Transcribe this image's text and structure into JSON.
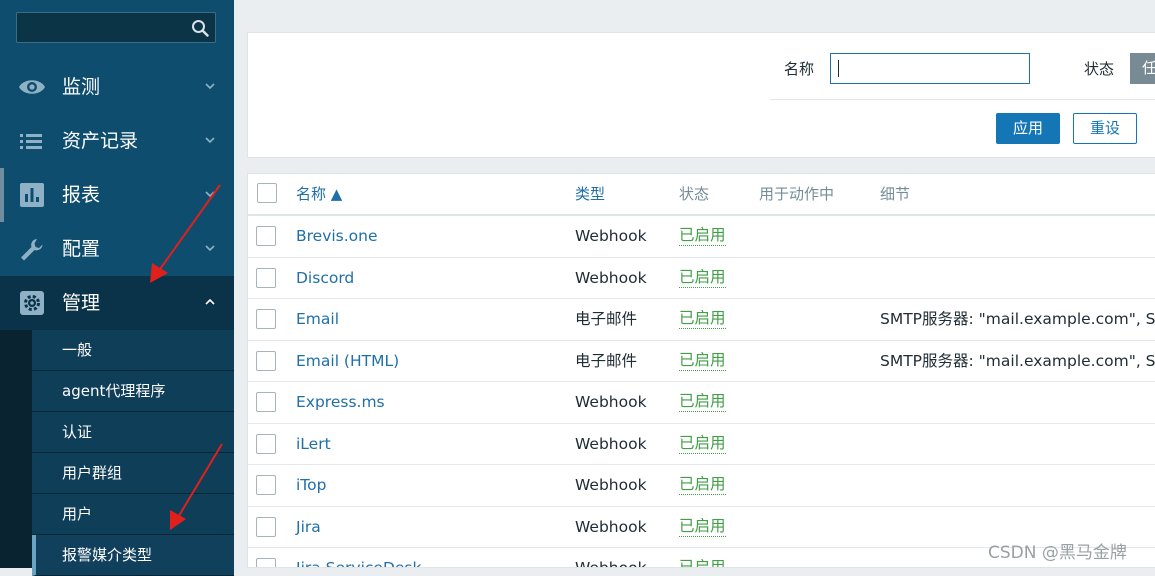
{
  "sidebar": {
    "menu": [
      {
        "label": "监测",
        "icon": "eye-icon"
      },
      {
        "label": "资产记录",
        "icon": "list-icon"
      },
      {
        "label": "报表",
        "icon": "bar-chart-icon"
      },
      {
        "label": "配置",
        "icon": "wrench-icon"
      },
      {
        "label": "管理",
        "icon": "gear-icon"
      }
    ],
    "admin_submenu": [
      "一般",
      "agent代理程序",
      "认证",
      "用户群组",
      "用户",
      "报警媒介类型"
    ]
  },
  "filter": {
    "name_label": "名称",
    "name_value": "",
    "status_label": "状态",
    "status_toggle": "任",
    "apply": "应用",
    "reset": "重设"
  },
  "table": {
    "headers": {
      "name": "名称 ▲",
      "type": "类型",
      "status": "状态",
      "used_in_actions": "用于动作中",
      "details": "细节"
    },
    "rows": [
      {
        "name": "Brevis.one",
        "type": "Webhook",
        "status": "已启用",
        "details": ""
      },
      {
        "name": "Discord",
        "type": "Webhook",
        "status": "已启用",
        "details": ""
      },
      {
        "name": "Email",
        "type": "电子邮件",
        "status": "已启用",
        "details": "SMTP服务器: \"mail.example.com\", SM"
      },
      {
        "name": "Email (HTML)",
        "type": "电子邮件",
        "status": "已启用",
        "details": "SMTP服务器: \"mail.example.com\", SM"
      },
      {
        "name": "Express.ms",
        "type": "Webhook",
        "status": "已启用",
        "details": ""
      },
      {
        "name": "iLert",
        "type": "Webhook",
        "status": "已启用",
        "details": ""
      },
      {
        "name": "iTop",
        "type": "Webhook",
        "status": "已启用",
        "details": ""
      },
      {
        "name": "Jira",
        "type": "Webhook",
        "status": "已启用",
        "details": ""
      },
      {
        "name": "Jira ServiceDesk",
        "type": "Webhook",
        "status": "已启用",
        "details": ""
      }
    ]
  },
  "watermark": "CSDN @黑马金牌",
  "colors": {
    "sidebar": "#0e4d6e",
    "link": "#1f6fa8",
    "enabled": "#429e47",
    "primary": "#1576b6",
    "annotation_arrow": "#e0201b"
  }
}
